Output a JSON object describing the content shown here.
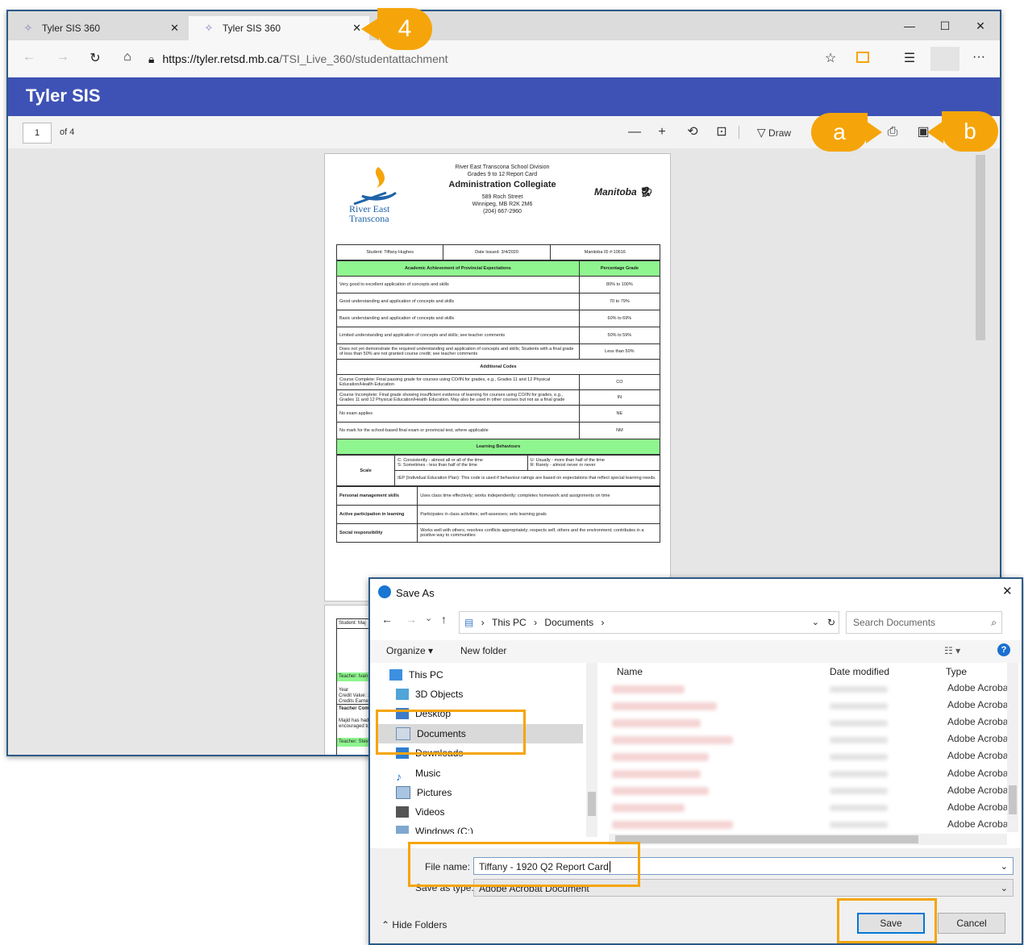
{
  "browser": {
    "tabs": [
      {
        "label": "Tyler SIS 360"
      },
      {
        "label": "Tyler SIS 360"
      }
    ],
    "url_host": "https://tyler.retsd.mb.ca",
    "url_path": "/TSI_Live_360/studentattachment"
  },
  "app": {
    "title": "Tyler SIS"
  },
  "viewer": {
    "page_current": "1",
    "page_total": "of 4",
    "draw_label": "Draw"
  },
  "callouts": {
    "step": "4",
    "a": "a",
    "b": "b"
  },
  "report": {
    "division": "River East Transcona School Division",
    "card": "Grades 9 to 12 Report Card",
    "school": "Administration Collegiate",
    "street": "589 Roch Street",
    "city": "Winnipeg, MB R2K 2M6",
    "phone": "(204) 667-2960",
    "logo_line1": "River East",
    "logo_line2": "Transcona",
    "province_logo": "Manitoba",
    "student": "Student: Tiffany Hughes",
    "date_issued": "Date Issued: 3/4/2020",
    "manitoba_id": "Manitoba ID #:10616",
    "hdr_achievement": "Academic Achievement of Provincial Expectations",
    "hdr_percentage": "Percentage Grade",
    "rows": [
      {
        "desc": "Very good to excellent application of concepts and skills",
        "grade": "80% to 100%"
      },
      {
        "desc": "Good understanding and application of concepts and skills",
        "grade": "70 to 79%"
      },
      {
        "desc": "Basic understanding and application of concepts and skills",
        "grade": "60% to 69%"
      },
      {
        "desc": "Limited understanding and application of concepts and skills; see teacher comments",
        "grade": "50% to 59%"
      },
      {
        "desc": "Does not yet demonstrate the required understanding and application of concepts and skills; Students with a final grade of less than 50% are not granted course credit; see teacher comments",
        "grade": "Less than 50%"
      }
    ],
    "hdr_additional": "Additional Codes",
    "codes": [
      {
        "desc": "Course Complete: Final passing grade for courses using CO/IN for grades, e.g., Grades 11 and 12 Physical Education/Health Education",
        "code": "CO"
      },
      {
        "desc": "Course Incomplete: Final grade showing insufficient evidence of learning for courses using CO/IN for grades, e.g., Grades 11 and 12 Physical Education/Health Education. May also be used in other courses but not as a final grade",
        "code": "IN"
      },
      {
        "desc": "No exam applies",
        "code": "NE"
      },
      {
        "desc": "No mark for the school-based final exam or provincial test, where applicable",
        "code": "NM"
      }
    ],
    "hdr_behaviours": "Learning Behaviours",
    "scale_label": "Scale",
    "scale_c": "C: Consistently - almost all or all of the time",
    "scale_s": "S: Sometimes - less than half of the time",
    "scale_u": "U: Usually - more than half of the time",
    "scale_r": "R: Rarely - almost never or never",
    "scale_iep": "IEP (Individual Education Plan): This code is used if behaviour ratings are based on expectations that reflect special learning needs.",
    "behaviours": [
      {
        "name": "Personal management skills",
        "desc": "Uses class time effectively; works independently; completes homework and assignments on time"
      },
      {
        "name": "Active participation in learning",
        "desc": "Participates in class activities; self-assesses; sets learning goals"
      },
      {
        "name": "Social responsibility",
        "desc": "Works well with others; resolves conflicts appropriately; respects self, others and the environment; contributes in a positive way to communities"
      }
    ],
    "page2_lines": [
      "Student: Maj",
      "Teacher: Ivan H",
      "Year",
      "Credit Value: 1.",
      "Credits Earned:",
      "Teacher Comme",
      "Majid has had g",
      "encouraged to c",
      "Teacher: Steve"
    ]
  },
  "dialog": {
    "title": "Save As",
    "crumb_root": "This PC",
    "crumb_folder": "Documents",
    "search_placeholder": "Search Documents",
    "organize": "Organize",
    "new_folder": "New folder",
    "folders": [
      "This PC",
      "3D Objects",
      "Desktop",
      "Documents",
      "Downloads",
      "Music",
      "Pictures",
      "Videos",
      "Windows (C:)"
    ],
    "col_name": "Name",
    "col_date": "Date modified",
    "col_type": "Type",
    "file_type": "Adobe Acroba",
    "file_name_label": "File name:",
    "file_name_value": "Tiffany - 1920 Q2 Report Card",
    "save_type_label": "Save as type:",
    "save_type_value": "Adobe Acrobat Document",
    "hide_folders": "Hide Folders",
    "save": "Save",
    "cancel": "Cancel"
  },
  "colors": {
    "accent_orange": "#f5a50a",
    "app_blue": "#3e52b5",
    "table_green": "#8ff58f"
  }
}
